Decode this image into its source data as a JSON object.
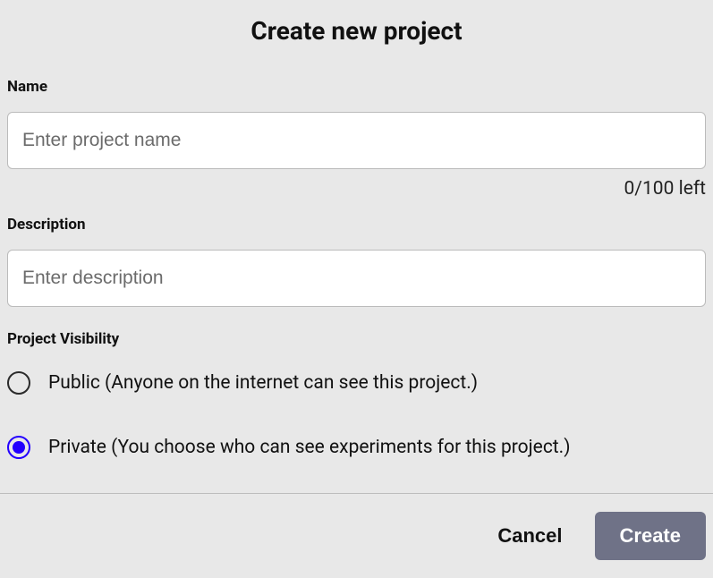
{
  "dialog": {
    "title": "Create new project"
  },
  "name": {
    "label": "Name",
    "placeholder": "Enter project name",
    "value": "",
    "counter": "0/100 left"
  },
  "description": {
    "label": "Description",
    "placeholder": "Enter description",
    "value": ""
  },
  "visibility": {
    "label": "Project Visibility",
    "options": {
      "public": {
        "label": "Public (Anyone on the internet can see this project.)",
        "selected": false
      },
      "private": {
        "label": "Private (You choose who can see experiments for this project.)",
        "selected": true
      }
    }
  },
  "actions": {
    "cancel": "Cancel",
    "create": "Create"
  }
}
